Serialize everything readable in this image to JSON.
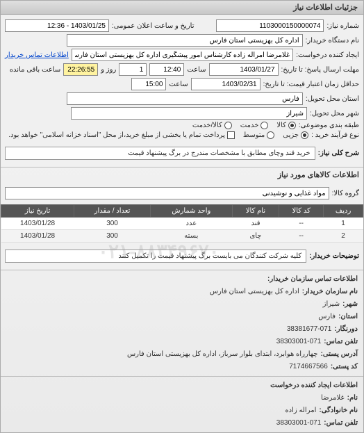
{
  "header": {
    "title": "جزئیات اطلاعات نیاز"
  },
  "fields": {
    "request_number_label": "شماره نیاز:",
    "request_number": "1103000150000074",
    "public_announce_label": "تاریخ و ساعت اعلان عمومی:",
    "public_announce_value": "1403/01/25 - 12:36",
    "buyer_label": "نام دستگاه خریدار:",
    "buyer_value": "اداره کل بهزیستی استان فارس",
    "creator_label": "ایجاد کننده درخواست:",
    "creator_value": "غلامرضا امراله زاده کارشناس امور پیشگیری اداره کل بهزیستی استان فارس",
    "contact_link": "اطلاعات تماس خریدار",
    "deadline_label": "مهلت ارسال پاسخ: تا تاریخ:",
    "deadline_date": "1403/01/27",
    "deadline_time_label": "ساعت",
    "deadline_time": "12:40",
    "deadline_day_label": "روز و",
    "deadline_day": "1",
    "remaining_label": "ساعت باقی مانده",
    "remaining_time": "22:26:55",
    "delivery_label": "حداقل زمان اعتبار قیمت: تا تاریخ:",
    "delivery_date": "1403/02/31",
    "delivery_time_label": "ساعت",
    "delivery_time": "15:00",
    "province_label": "استان محل تحویل:",
    "province_value": "فارس",
    "city_label": "شهر محل تحویل:",
    "city_value": "شیراز",
    "category_label": "طبقه بندی موضوعی:",
    "cat_goods": "کالا",
    "cat_service": "خدمت",
    "cat_goods_service": "کالا/خدمت",
    "purchase_type_label": "نوع فرآیند خرید :",
    "pt_small": "جزیی",
    "pt_medium": "متوسط",
    "pt_note": "پرداخت تمام یا بخشی از مبلغ خرید،از محل \"اسناد خزانه اسلامی\" خواهد بود.",
    "general_desc_label": "شرح کلی نیاز:",
    "general_desc_value": "خرید قند وچای مطابق با مشخصات مندرج در برگ پیشنهاد قیمت",
    "goods_info_title": "اطلاعات کالاهای مورد نیاز",
    "goods_group_label": "گروه کالا:",
    "goods_group_value": "مواد غذایی و نوشیدنی"
  },
  "table": {
    "headers": {
      "row": "ردیف",
      "code": "کد کالا",
      "name": "نام کالا",
      "unit": "واحد شمارش",
      "qty": "تعداد / مقدار",
      "date": "تاریخ نیاز"
    },
    "rows": [
      {
        "row": "1",
        "code": "--",
        "name": "قند",
        "unit": "عدد",
        "qty": "300",
        "date": "1403/01/28"
      },
      {
        "row": "2",
        "code": "--",
        "name": "چای",
        "unit": "بسته",
        "qty": "300",
        "date": "1403/01/28"
      }
    ]
  },
  "buyer_notes": {
    "label": "توضیحات خریدار:",
    "value": "کلیه شرکت کنندگان می بایست برگ پیشنهاد قیمت را تکمیل کنند"
  },
  "watermark": "۰۲۱-۸۸۳۴۹۶۷۰",
  "contact_info": {
    "title": "اطلاعات تماس سازمان خریدار:",
    "org_label": "نام سازمان خریدار:",
    "org_value": "اداره کل بهزیستی استان فارس",
    "city_label": "شهر:",
    "city_value": "شیراز",
    "province_label": "استان:",
    "province_value": "فارس",
    "fax_label": "دورنگار:",
    "fax_value": "38381677-071",
    "phone_label": "تلفن تماس:",
    "phone_value": "38303001-071",
    "address_label": "آدرس پستی:",
    "address_value": "چهارراه هوابرد، ابتدای بلوار سرباز، اداره کل بهزیستی استان فارس",
    "postal_label": "کد پستی:",
    "postal_value": "7174667566"
  },
  "creator_info": {
    "title": "اطلاعات ایجاد کننده درخواست",
    "name_label": "نام:",
    "name_value": "غلامرضا",
    "family_label": "نام خانوادگی:",
    "family_value": "امراله زاده",
    "phone_label": "تلفن تماس:",
    "phone_value": "38303001-071"
  }
}
